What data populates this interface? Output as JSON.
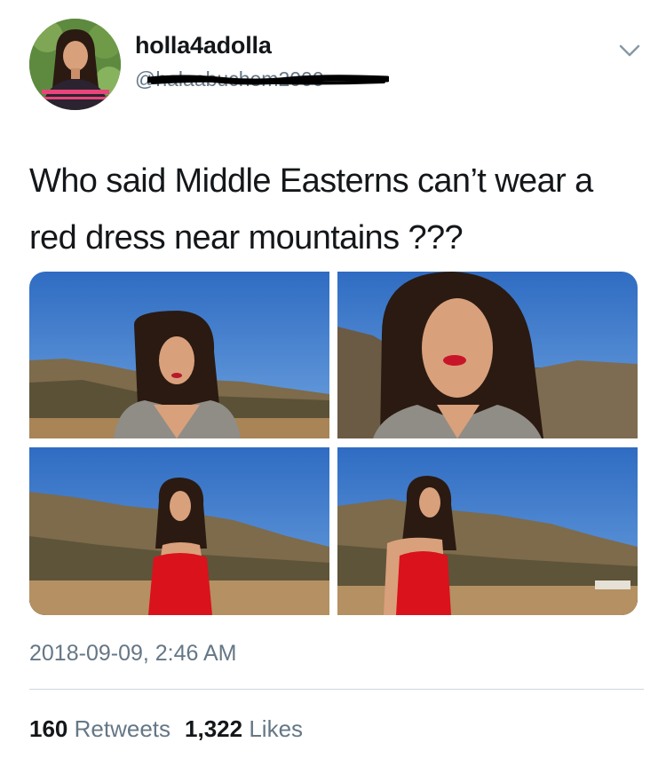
{
  "user": {
    "display_name": "holla4adolla",
    "handle": "@halaabuchem2000"
  },
  "tweet": {
    "text": "Who said Middle Easterns can’t wear a red dress near mountains ???",
    "timestamp": "2018-09-09, 2:46 AM"
  },
  "stats": {
    "retweets_count": "160",
    "retweets_label": "Retweets",
    "likes_count": "1,322",
    "likes_label": "Likes"
  },
  "icons": {
    "menu": "chevron-down-icon"
  },
  "colors": {
    "primary_text": "#14171a",
    "secondary_text": "#657786",
    "divider": "#d0d5da",
    "dress_red": "#d9121c",
    "sky_blue": "#3a77c9"
  }
}
